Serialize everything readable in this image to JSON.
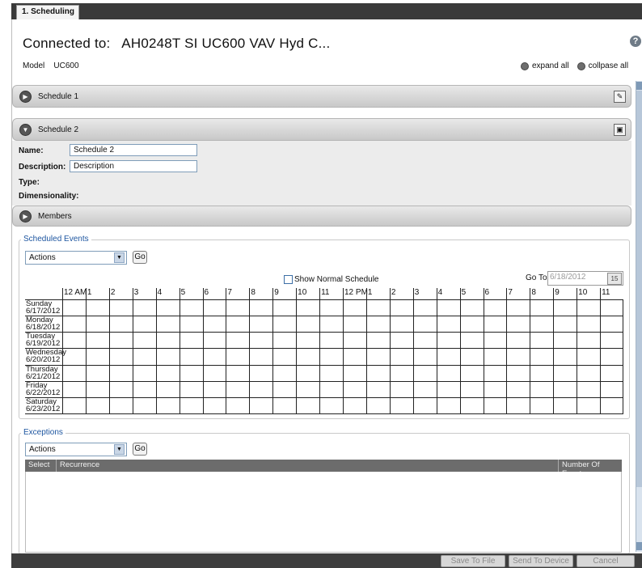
{
  "tab": {
    "label": "1. Scheduling"
  },
  "header": {
    "connected_label": "Connected to:",
    "device_name": "AH0248T SI UC600 VAV Hyd C...",
    "help": "?",
    "model_label": "Model",
    "model_value": "UC600",
    "expand_all": "expand all",
    "collapse_all": "collpase all"
  },
  "schedule1": {
    "title": "Schedule 1"
  },
  "schedule2": {
    "title": "Schedule 2",
    "name_label": "Name:",
    "name_value": "Schedule 2",
    "description_label": "Description:",
    "description_value": "Description",
    "type_label": "Type:",
    "dimensionality_label": "Dimensionality:"
  },
  "members": {
    "title": "Members"
  },
  "scheduled_events": {
    "legend": "Scheduled Events",
    "actions_value": "Actions",
    "go_label": "Go",
    "show_normal_schedule": "Show Normal Schedule",
    "goto_label": "Go To",
    "goto_value": "6/18/2012",
    "calendar_label": "15",
    "hours": [
      "12 AM",
      "1",
      "2",
      "3",
      "4",
      "5",
      "6",
      "7",
      "8",
      "9",
      "10",
      "11",
      "12 PM",
      "1",
      "2",
      "3",
      "4",
      "5",
      "6",
      "7",
      "8",
      "9",
      "10",
      "11"
    ],
    "days": [
      {
        "day": "Sunday",
        "date": "6/17/2012"
      },
      {
        "day": "Monday",
        "date": "6/18/2012"
      },
      {
        "day": "Tuesday",
        "date": "6/19/2012"
      },
      {
        "day": "Wednesday",
        "date": "6/20/2012"
      },
      {
        "day": "Thursday",
        "date": "6/21/2012"
      },
      {
        "day": "Friday",
        "date": "6/22/2012"
      },
      {
        "day": "Saturday",
        "date": "6/23/2012"
      }
    ]
  },
  "exceptions": {
    "legend": "Exceptions",
    "actions_value": "Actions",
    "go_label": "Go",
    "columns": {
      "select": "Select",
      "recurrence": "Recurrence",
      "number_of_events": "Number Of Events"
    }
  },
  "footer": {
    "save_to_file": "Save To File",
    "send_to_device": "Send To Device",
    "cancel": "Cancel"
  }
}
